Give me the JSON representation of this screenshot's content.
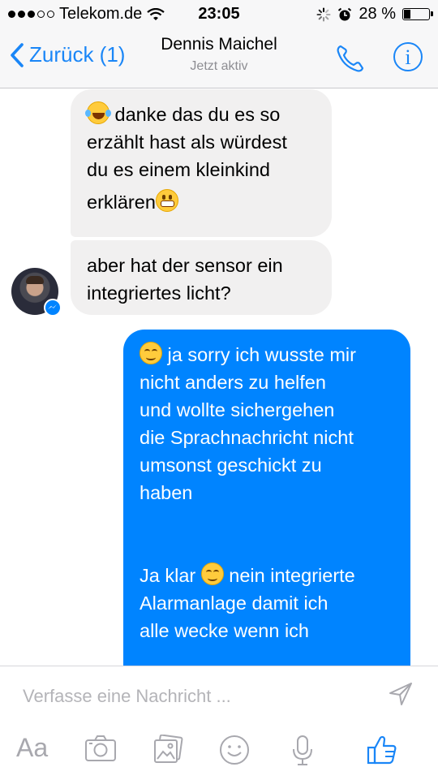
{
  "status_bar": {
    "carrier": "Telekom.de",
    "time": "23:05",
    "battery": "28 %",
    "battery_level": 0.28
  },
  "nav": {
    "back_label": "Zurück (1)",
    "contact_name": "Dennis Maichel",
    "contact_status": "Jetzt aktiv"
  },
  "messages": [
    {
      "direction": "incoming",
      "lines": [
        "danke das du es so",
        "erzählt hast als würdest",
        "du es einem kleinkind",
        "erklären"
      ],
      "emojis": [
        "face-with-tears-of-joy",
        "grimacing-face"
      ]
    },
    {
      "direction": "incoming",
      "lines": [
        "aber hat der sensor ein",
        "integriertes licht?"
      ]
    },
    {
      "direction": "outgoing",
      "lines": [
        "ja sorry ich wusste mir",
        "nicht anders zu helfen",
        "und wollte sichergehen",
        "die Sprachnachricht nicht",
        "umsonst geschickt zu",
        "haben",
        "Ja klar",
        "nein integrierte",
        "Alarmanlage damit ich",
        "alle wecke wenn ich"
      ],
      "emojis": [
        "smiling-face",
        "smiling-face"
      ]
    }
  ],
  "composer": {
    "placeholder": "Verfasse eine Nachricht ...",
    "text_button": "Aa"
  },
  "colors": {
    "accent": "#1a86f7",
    "outgoing_bubble": "#0084ff",
    "incoming_bubble": "#f1f0f0"
  }
}
